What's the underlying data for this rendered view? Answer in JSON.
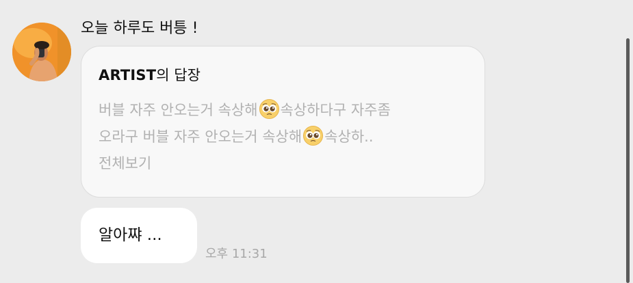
{
  "message": {
    "header_text": "오늘 하루도 버틍 !",
    "reply_card": {
      "artist": "ARTIST",
      "title_suffix": "의 답장",
      "line1_part1": "버블 자주 안오는거 속상해",
      "line1_part2": "속상하다구 자주좀",
      "line2_part1": "오라구 버블 자주 안오는거 속상해",
      "line2_part2": "속상하..",
      "more_label": "전체보기",
      "emoji_icon": "pleading-face-emoji"
    },
    "bubble_text": "알아쨔 ...",
    "timestamp": "오후 11:31"
  },
  "colors": {
    "background": "#ececec",
    "card_background": "#f8f8f8",
    "muted_text": "#b1b1b1",
    "timestamp_text": "#a8a8a8",
    "scrollbar": "#5a5a5a"
  }
}
